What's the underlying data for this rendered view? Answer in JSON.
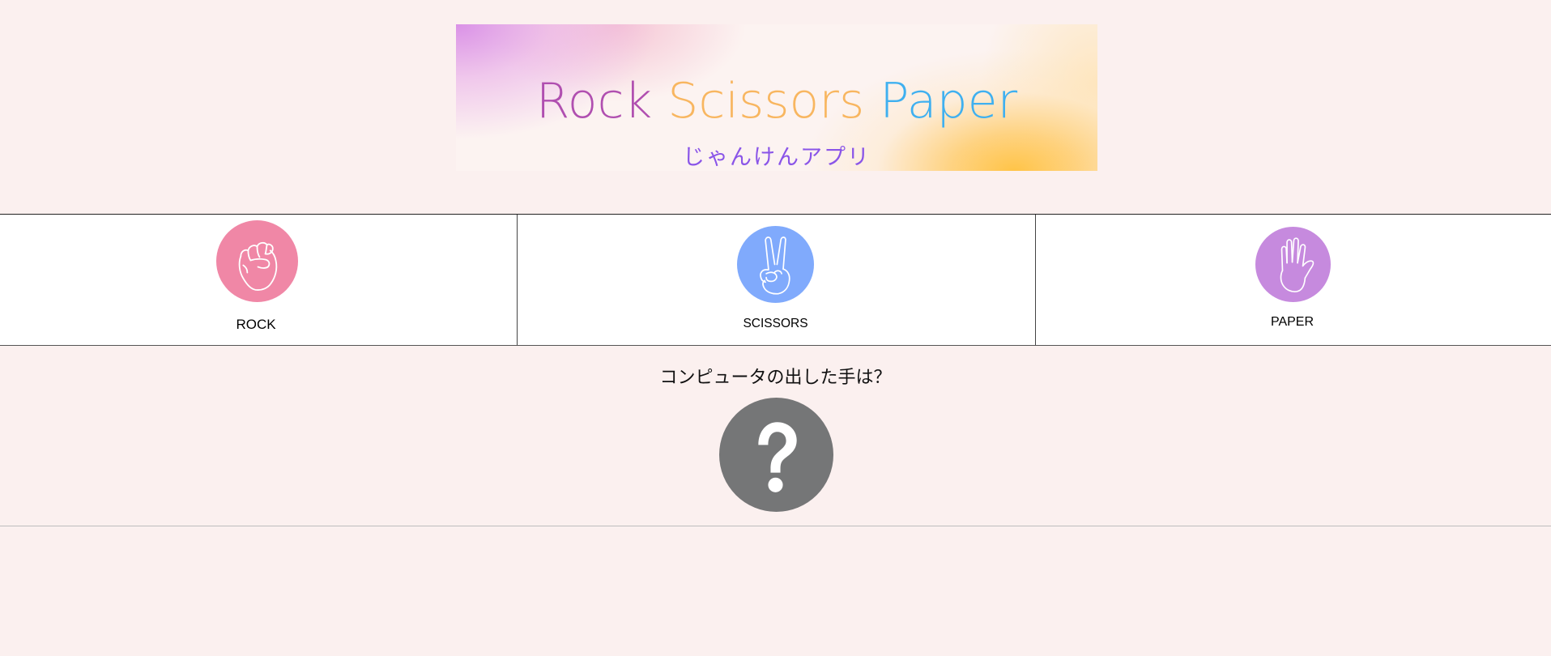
{
  "banner": {
    "title_words": [
      "Rock",
      "Scissors",
      "Paper"
    ],
    "subtitle": "じゃんけんアプリ"
  },
  "choices": [
    {
      "label": "ROCK",
      "icon": "fist-icon",
      "color": "#f087a6"
    },
    {
      "label": "SCISSORS",
      "icon": "peace-sign-icon",
      "color": "#80aafc"
    },
    {
      "label": "PAPER",
      "icon": "open-hand-icon",
      "color": "#c68ade"
    }
  ],
  "result": {
    "prompt": "コンピュータの出した手は？",
    "icon": "question-mark-icon",
    "icon_color": "#757677"
  },
  "colors": {
    "background": "#fbf0ef",
    "title_rock": "#b04fb0",
    "title_scissors": "#f8b660",
    "title_paper": "#3fb0f0",
    "subtitle": "#8a55e8"
  }
}
